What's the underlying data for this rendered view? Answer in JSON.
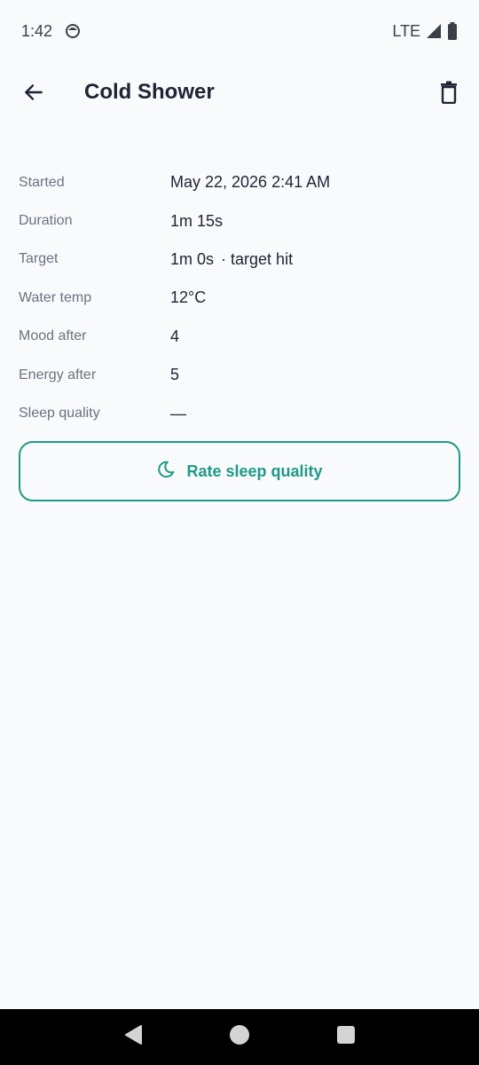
{
  "status_bar": {
    "time": "1:42",
    "network": "LTE",
    "icons": [
      "notification-face-icon",
      "signal-icon",
      "battery-icon"
    ]
  },
  "app_bar": {
    "title": "Cold Shower",
    "back_icon": "arrow-back-icon",
    "delete_icon": "trash-icon"
  },
  "details": [
    {
      "label": "Started",
      "value": "May 22, 2026 2:41 AM",
      "extra": ""
    },
    {
      "label": "Duration",
      "value": "1m 15s",
      "extra": ""
    },
    {
      "label": "Target",
      "value": "1m 0s",
      "extra": "· target hit"
    },
    {
      "label": "Water temp",
      "value": "12°C",
      "extra": ""
    },
    {
      "label": "Mood after",
      "value": "4",
      "extra": ""
    },
    {
      "label": "Energy after",
      "value": "5",
      "extra": ""
    },
    {
      "label": "Sleep quality",
      "value": "—",
      "extra": ""
    }
  ],
  "rate_button": {
    "label": "Rate sleep quality",
    "icon": "moon-icon"
  },
  "colors": {
    "accent": "#1f9a87",
    "background": "#f8fafc",
    "text_primary": "#1e2433",
    "text_secondary": "#6b7280"
  },
  "nav_bar": {
    "icons": [
      "back-triangle-icon",
      "home-circle-icon",
      "recents-square-icon"
    ]
  }
}
